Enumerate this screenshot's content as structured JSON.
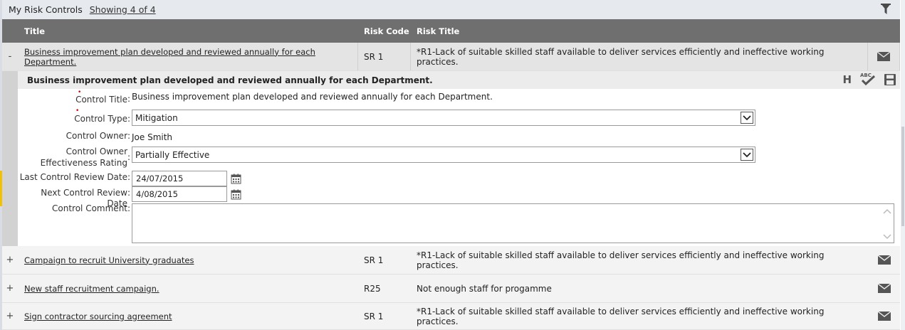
{
  "header": {
    "title": "My Risk Controls",
    "count": "Showing 4 of 4"
  },
  "columns": {
    "title": "Title",
    "risk_code": "Risk Code",
    "risk_title": "Risk Title"
  },
  "rows": [
    {
      "toggle": "-",
      "title": "Business improvement plan developed and reviewed annually for each Department.",
      "risk_code": "SR 1",
      "risk_title": "*R1-Lack of suitable skilled staff available to deliver services efficiently and ineffective working practices."
    },
    {
      "toggle": "+",
      "title": "Campaign to recruit University graduates",
      "risk_code": "SR 1",
      "risk_title": "*R1-Lack of suitable skilled staff available to deliver services efficiently and ineffective working practices."
    },
    {
      "toggle": "+",
      "title": "New staff recruitment campaign.",
      "risk_code": "R25",
      "risk_title": "Not enough staff for progamme"
    },
    {
      "toggle": "+",
      "title": "Sign contractor sourcing agreement",
      "risk_code": "SR 1",
      "risk_title": "*R1-Lack of suitable skilled staff available to deliver services efficiently and ineffective working practices."
    }
  ],
  "detail": {
    "heading": "Business improvement plan developed and reviewed annually for each Department.",
    "tool_h": "H",
    "tool_spell": "ABC",
    "fields": {
      "control_title": {
        "label": "Control Title",
        "value": "Business improvement plan developed and reviewed annually for each Department."
      },
      "control_type": {
        "label": "Control Type",
        "value": "Mitigation"
      },
      "control_owner": {
        "label": "Control Owner",
        "value": "Joe Smith"
      },
      "effectiveness": {
        "label_line1": "Control Owner",
        "label_line2": "Effectiveness Rating",
        "value": "Partially Effective"
      },
      "last_review": {
        "label": "Last Control Review Date",
        "value": "24/07/2015"
      },
      "next_review": {
        "label": "Next Control Review Date",
        "value": "4/08/2015"
      },
      "comment": {
        "label": "Control Comment",
        "value": ""
      }
    },
    "colon": ":"
  },
  "icons": {
    "filter": "filter-icon",
    "mail": "envelope-icon",
    "calendar": "calendar-icon",
    "save": "save-icon",
    "spellcheck": "spellcheck-icon",
    "dropdown": "chevron-down-icon"
  },
  "colors": {
    "column_header": "#6f6f6f",
    "row_bg": "#f3f3f3",
    "header_bar": "#e6e9ee",
    "required": "#cc0000"
  }
}
